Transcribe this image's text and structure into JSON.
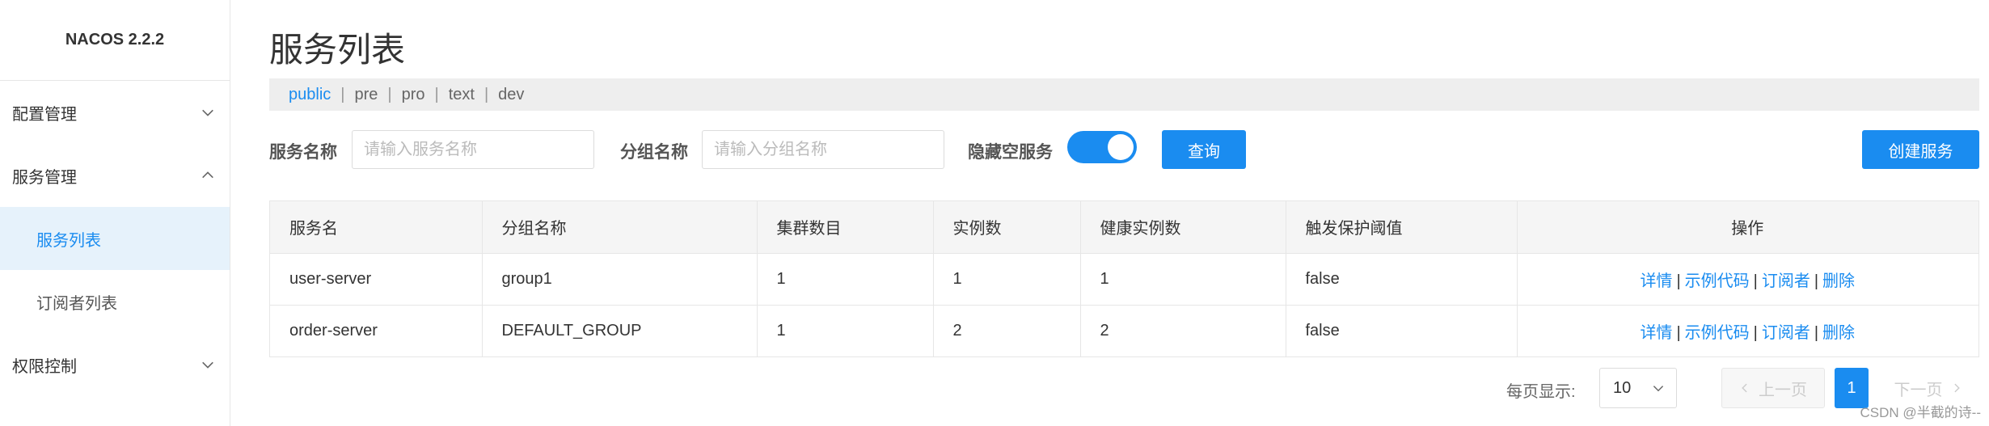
{
  "sidebar": {
    "brand": "NACOS 2.2.2",
    "items": [
      {
        "label": "配置管理"
      },
      {
        "label": "服务管理"
      },
      {
        "label": "服务列表"
      },
      {
        "label": "订阅者列表"
      },
      {
        "label": "权限控制"
      }
    ]
  },
  "page": {
    "title": "服务列表"
  },
  "namespaces": [
    "public",
    "pre",
    "pro",
    "text",
    "dev"
  ],
  "filters": {
    "service_name_label": "服务名称",
    "service_name_placeholder": "请输入服务名称",
    "group_name_label": "分组名称",
    "group_name_placeholder": "请输入分组名称",
    "hide_empty_label": "隐藏空服务",
    "query_button": "查询",
    "create_button": "创建服务"
  },
  "table": {
    "columns": [
      "服务名",
      "分组名称",
      "集群数目",
      "实例数",
      "健康实例数",
      "触发保护阈值",
      "操作"
    ],
    "rows": [
      {
        "service": "user-server",
        "group": "group1",
        "clusters": "1",
        "instances": "1",
        "healthy": "1",
        "threshold": "false"
      },
      {
        "service": "order-server",
        "group": "DEFAULT_GROUP",
        "clusters": "1",
        "instances": "2",
        "healthy": "2",
        "threshold": "false"
      }
    ],
    "actions": [
      "详情",
      "示例代码",
      "订阅者",
      "删除"
    ]
  },
  "pagination": {
    "page_size_label": "每页显示:",
    "page_size": "10",
    "prev": "上一页",
    "current": "1",
    "next": "下一页"
  },
  "watermark": "CSDN @半截的诗--",
  "colors": {
    "accent": "#1a8cf0"
  }
}
